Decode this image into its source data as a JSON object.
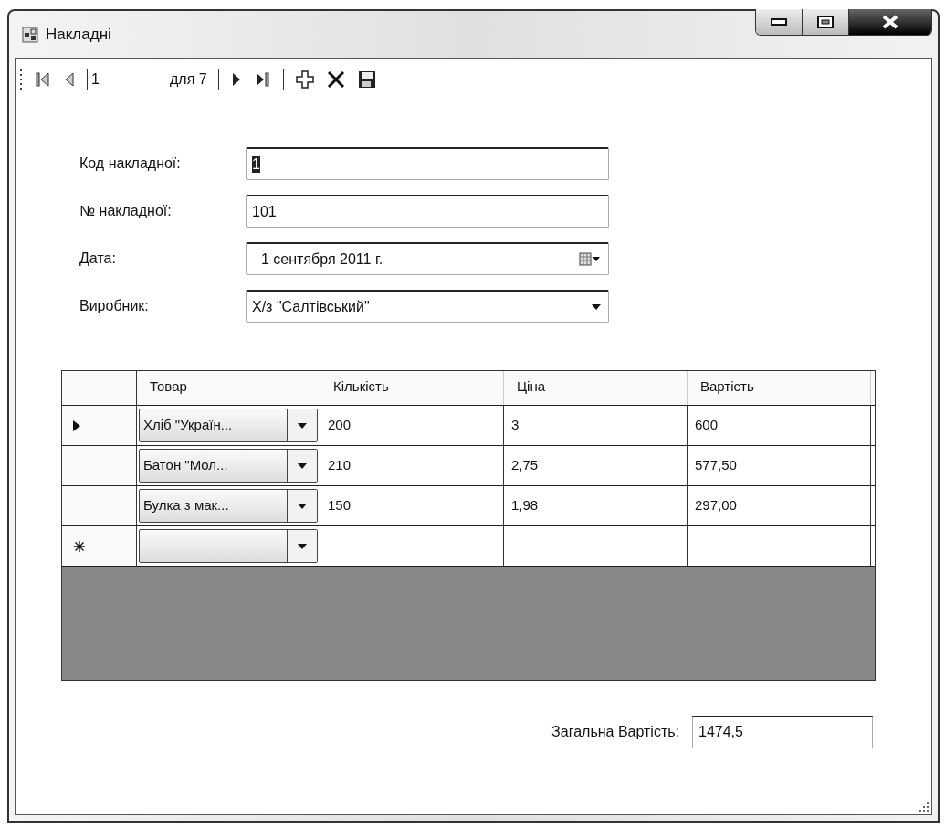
{
  "window": {
    "title": "Накладні"
  },
  "toolbar": [
    {
      "kind": "first"
    },
    {
      "kind": "prev"
    },
    {
      "kind": "separator"
    },
    {
      "kind": "position",
      "value": "1"
    },
    {
      "kind": "label",
      "text": "для 7"
    },
    {
      "kind": "separator"
    },
    {
      "kind": "next"
    },
    {
      "kind": "last"
    },
    {
      "kind": "separator"
    },
    {
      "kind": "add"
    },
    {
      "kind": "delete"
    },
    {
      "kind": "save"
    }
  ],
  "fields": [
    {
      "label": "Код накладної:",
      "kind": "text",
      "value": "1",
      "text_selected": true
    },
    {
      "label": "№ накладної:",
      "kind": "text",
      "value": "101",
      "text_selected": false
    },
    {
      "label": "Дата:",
      "kind": "date",
      "value": "1 сентября 2011 г.",
      "text_selected": false
    },
    {
      "label": "Виробник:",
      "kind": "combo",
      "value": "Х/з \"Салтівський\"",
      "text_selected": false
    }
  ],
  "table": {
    "columns": [
      "Товар",
      "Кількість",
      "Ціна",
      "Вартість"
    ],
    "rows": [
      {
        "current": true,
        "new_row": false,
        "cells": [
          "Хліб \"Україн...",
          "200",
          "3",
          "600"
        ]
      },
      {
        "current": false,
        "new_row": false,
        "cells": [
          "Батон \"Мол...",
          "210",
          "2,75",
          "577,50"
        ]
      },
      {
        "current": false,
        "new_row": false,
        "cells": [
          "Булка з мак...",
          "150",
          "1,98",
          "297,00"
        ]
      },
      {
        "current": false,
        "new_row": true,
        "cells": [
          "",
          "",
          "",
          ""
        ]
      }
    ]
  },
  "total": {
    "label": "Загальна Вартість:",
    "value": "1474,5"
  }
}
